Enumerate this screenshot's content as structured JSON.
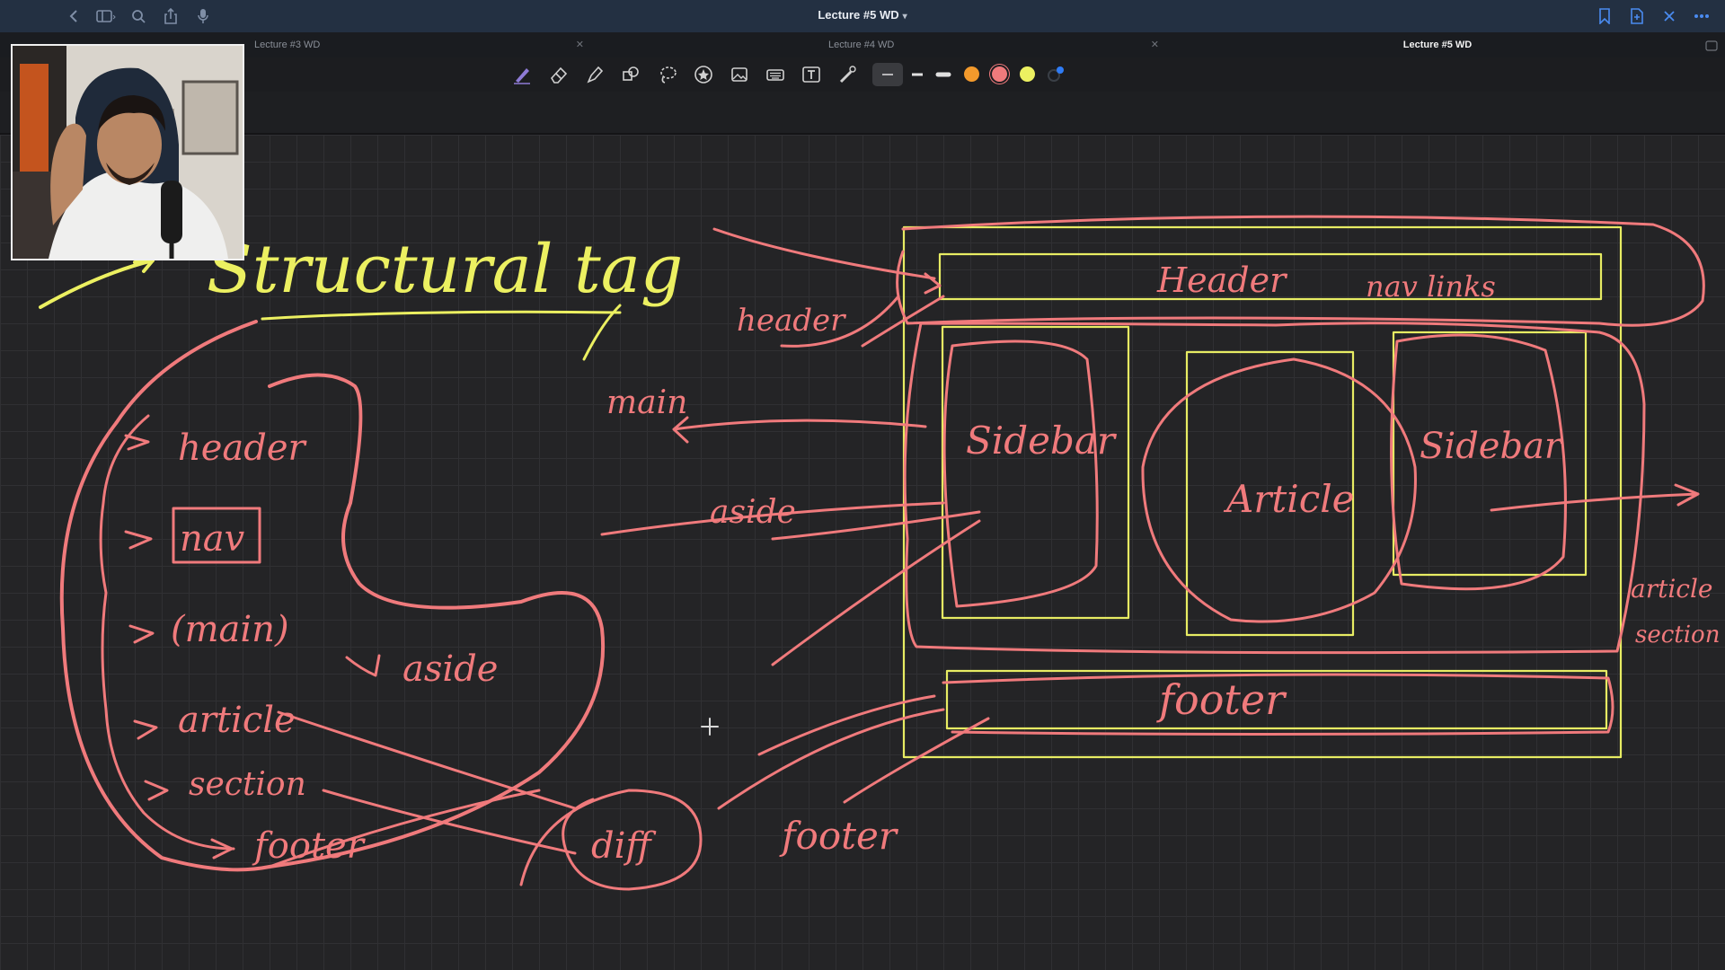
{
  "window": {
    "title": "Lecture #5 WD"
  },
  "titlebar_icons": [
    "back-chevron-icon",
    "sidebar-toggle-icon",
    "search-icon",
    "share-icon",
    "microphone-icon"
  ],
  "titlebar_right_icons": [
    "bookmark-icon",
    "new-page-icon",
    "close-icon",
    "more-icon"
  ],
  "tabs": [
    {
      "label": "Lecture #3 WD",
      "active": false
    },
    {
      "label": "Lecture #4 WD",
      "active": false
    },
    {
      "label": "Lecture #5 WD",
      "active": true
    }
  ],
  "tools": [
    "pen-icon",
    "eraser-icon",
    "highlighter-icon",
    "shapes-icon",
    "lasso-icon",
    "sticker-icon",
    "image-icon",
    "keyboard-icon",
    "text-icon",
    "laser-pointer-icon"
  ],
  "colors": {
    "pink": "#f07a7c",
    "yellow": "#ecf061",
    "orange": "#f39a2c",
    "accent_blue": "#2f7cf6"
  },
  "swatches": [
    "#f39a2c",
    "#f07a7c",
    "#ecf061",
    "#2f7cf6"
  ],
  "handwriting": {
    "title": "Structural tag",
    "tag_list": [
      "header",
      "nav",
      "(main)",
      "article",
      "section",
      "footer"
    ],
    "aside_label": "aside",
    "diff_label": "diff",
    "arrow_labels": [
      "header",
      "main",
      "aside",
      "footer"
    ],
    "layout_boxes": [
      "Header",
      "nav links",
      "Sidebar",
      "Article",
      "Sidebar",
      "footer"
    ],
    "right_labels": [
      "article",
      "section"
    ]
  }
}
